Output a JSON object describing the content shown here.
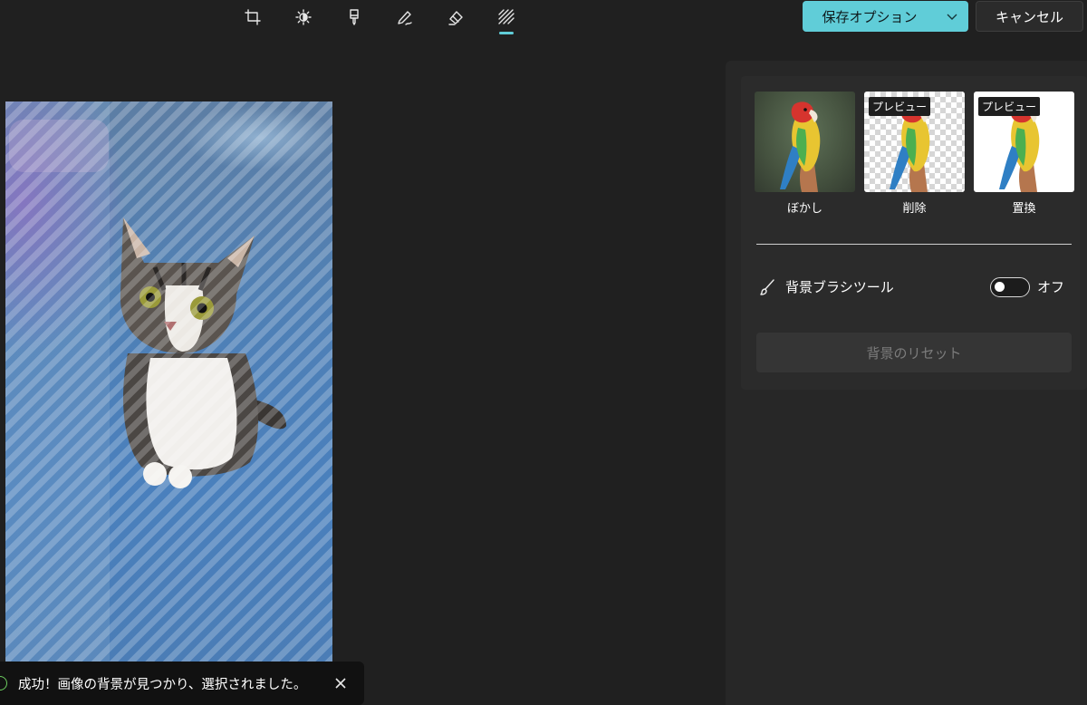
{
  "toolbar": {
    "tools": [
      {
        "icon": "crop-icon"
      },
      {
        "icon": "brightness-icon"
      },
      {
        "icon": "filter-brush-icon"
      },
      {
        "icon": "markup-pen-icon"
      },
      {
        "icon": "eraser-icon"
      },
      {
        "icon": "background-icon",
        "active": true
      }
    ],
    "save_label": "保存オプション",
    "save_menu_icon": "chevron-down-icon",
    "cancel_label": "キャンセル",
    "accent_color": "#60cdd8"
  },
  "toast": {
    "icon": "success-check-icon",
    "message": "成功！画像の背景が見つかり、選択されました。",
    "close_icon": "close-icon"
  },
  "background_panel": {
    "options": [
      {
        "label": "ぼかし",
        "badge": ""
      },
      {
        "label": "削除",
        "badge": "プレビュー"
      },
      {
        "label": "置換",
        "badge": "プレビュー"
      }
    ],
    "brush_tool_label": "背景ブラシツール",
    "brush_icon": "brush-icon",
    "brush_toggle_state": "オフ",
    "brush_toggle_on": false,
    "reset_label": "背景のリセット"
  }
}
